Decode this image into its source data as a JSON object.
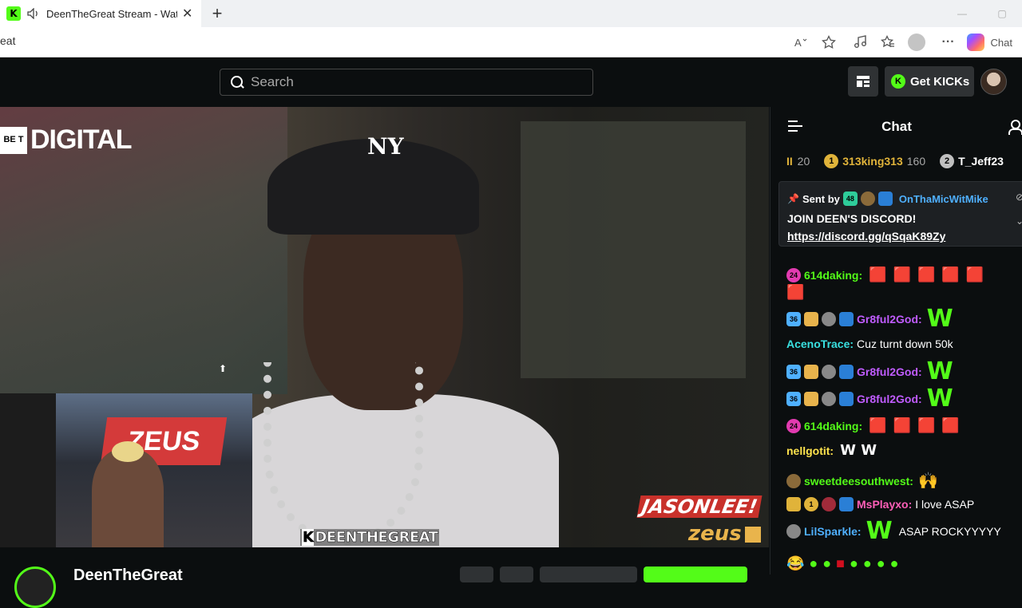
{
  "browser": {
    "tab_title": "DeenTheGreat Stream - Watch",
    "tab_close": "✕",
    "new_tab": "+",
    "url_fragment": "eat",
    "copilot_label": "Chat",
    "win_min": "—",
    "win_max": "▢"
  },
  "header": {
    "search_placeholder": "Search",
    "get_kicks_label": "Get KICKs",
    "kick_coin": "K"
  },
  "video": {
    "bet_box": "BE T",
    "bet_digital": "DIGITAL",
    "cap_logo": "NY",
    "cam_banner": "ZEUS",
    "watermark_deen_k": "K",
    "watermark_deen": "DEENTHEGREAT",
    "watermark_jason": "JASONLEE!",
    "watermark_zeus": "zeus"
  },
  "below": {
    "channel_name": "DeenTheGreat"
  },
  "chat": {
    "title": "Chat",
    "leaderboard": [
      {
        "rank_prefix": "II",
        "rank": "20"
      },
      {
        "badge": "1",
        "badge_color": "#e0b33a",
        "name": "313king313",
        "name_color": "#e0b33a",
        "score": "160"
      },
      {
        "badge": "2",
        "badge_color": "#c0c0c0",
        "name": "T_Jeff23",
        "name_color": "#ffffff"
      }
    ],
    "pinned": {
      "sent_by": "Sent by",
      "sub_badge": "48",
      "username": "OnThaMicWitMike",
      "message": "JOIN DEEN'S DISCORD!",
      "link": "https://discord.gg/qSqaK89Zy"
    },
    "messages": [
      {
        "badge": "24",
        "badge_color": "#e23bb0",
        "user": "614daking:",
        "user_color": "#53fc18"
      },
      {
        "badge": "36",
        "badge_color": "#4fb0ff",
        "user": "Gr8ful2God:",
        "user_color": "#c05cff",
        "emote": "W"
      },
      {
        "user": "AcenoTrace:",
        "user_color": "#39e0e0",
        "text": "Cuz turnt down 50k"
      },
      {
        "badge": "36",
        "badge_color": "#4fb0ff",
        "user": "Gr8ful2God:",
        "user_color": "#c05cff",
        "emote": "W"
      },
      {
        "badge": "36",
        "badge_color": "#4fb0ff",
        "user": "Gr8ful2God:",
        "user_color": "#c05cff",
        "emote": "W"
      },
      {
        "badge": "24",
        "badge_color": "#e23bb0",
        "user": "614daking:",
        "user_color": "#53fc18"
      },
      {
        "user": "nellgotit:",
        "user_color": "#ffe34d",
        "emote": "W W"
      },
      {
        "user": "sweetdeesouthwest:",
        "user_color": "#53fc18"
      },
      {
        "badge": "1",
        "badge_color": "#e0b33a",
        "user": "MsPlayxo:",
        "user_color": "#ff5fb8",
        "text": "I love ASAP"
      },
      {
        "user": "LilSparkle:",
        "user_color": "#4fb0ff",
        "emote": "W",
        "text": "ASAP ROCKYYYYY"
      }
    ],
    "icons": {
      "red_emote": "🟥",
      "hands_emote": "🙌"
    }
  }
}
